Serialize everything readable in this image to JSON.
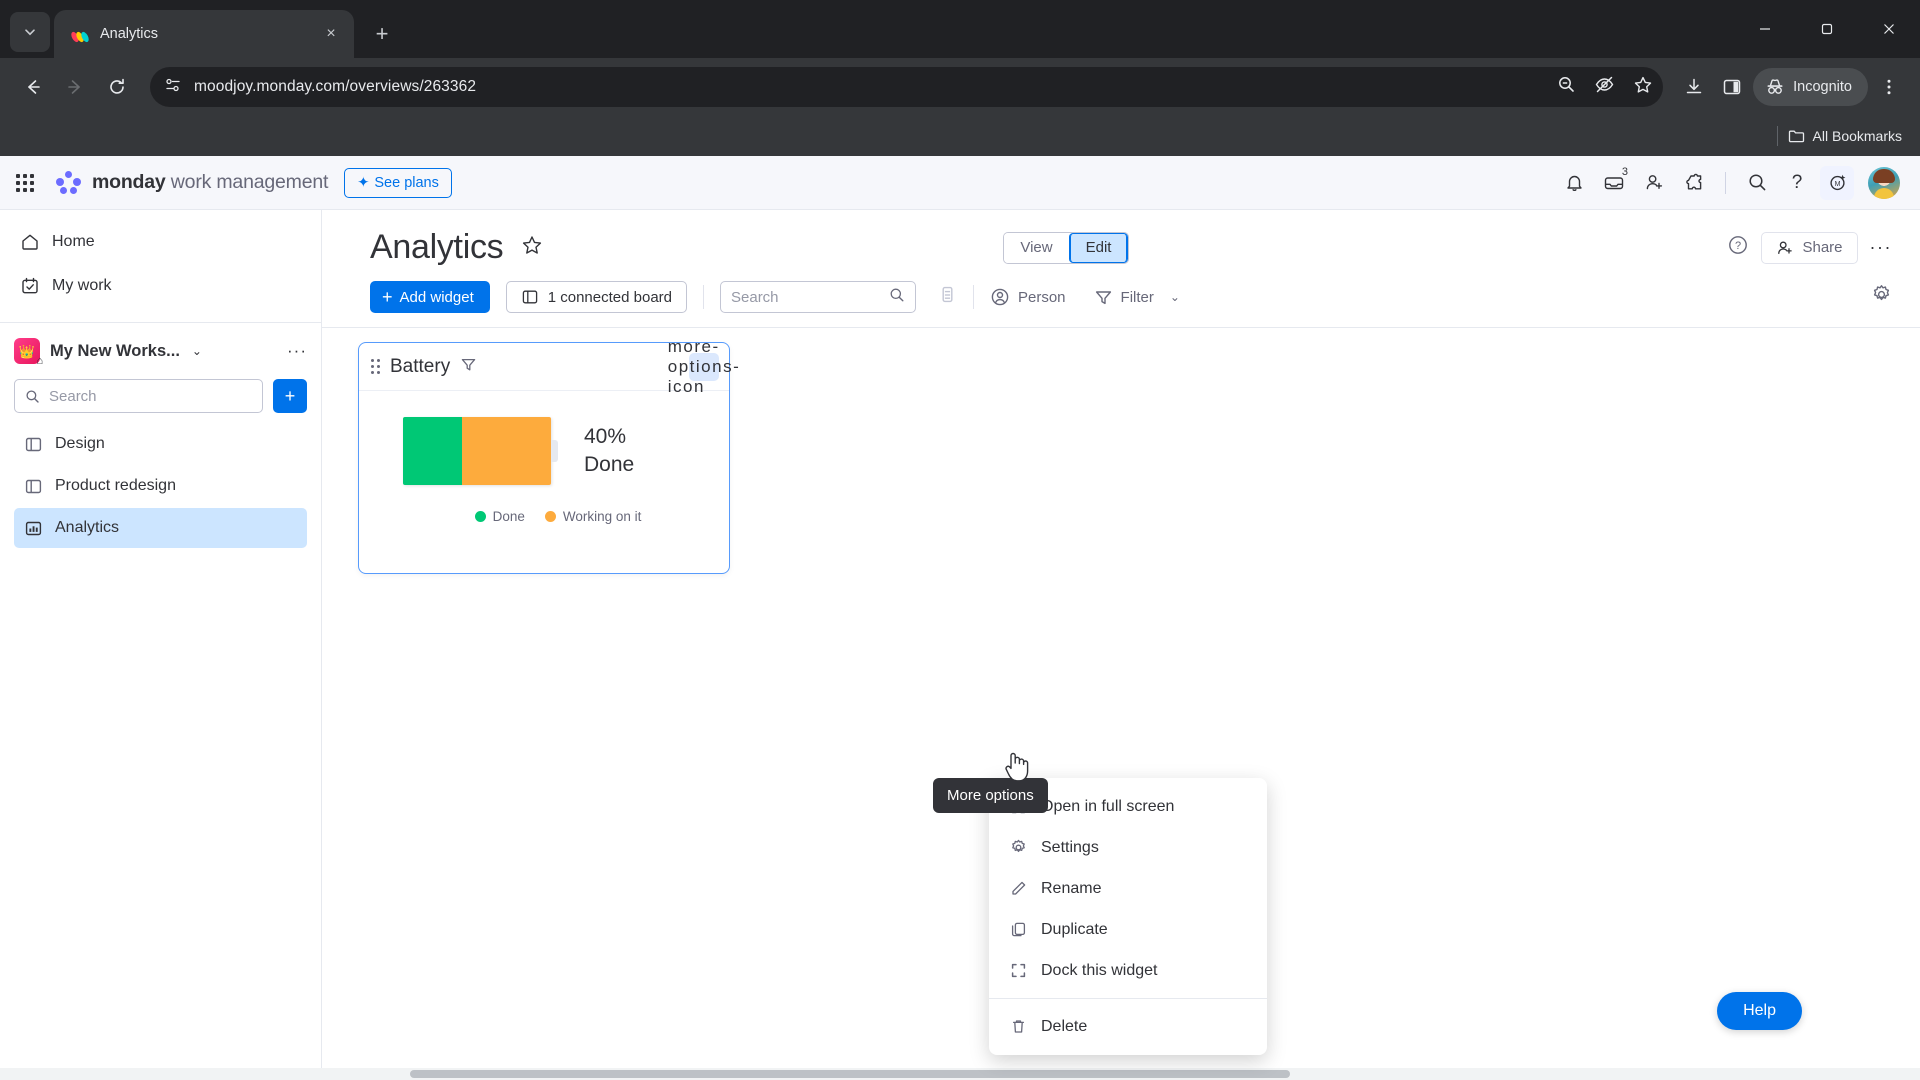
{
  "browser": {
    "tab": {
      "title": "Analytics",
      "favicon": "monday-logo-icon",
      "close": "×"
    },
    "new_tab_label": "+",
    "window": {
      "minimize": "—",
      "maximize": "▢",
      "close": "✕"
    },
    "nav": {
      "back": "←",
      "forward": "→",
      "reload": "⟳"
    },
    "omnibox": {
      "url": "moodjoy.monday.com/overviews/263362",
      "site_info_icon": "page-info-icon",
      "zoom_icon": "zoom-out-icon",
      "tracking_icon": "eye-off-icon",
      "bookmark_icon": "star-icon"
    },
    "toolbar_icons": {
      "downloads": "download-icon",
      "side_panel": "side-panel-icon",
      "incognito_label": "Incognito",
      "menu": "kebab-menu-icon"
    },
    "bookmarks_bar": {
      "all_bookmarks": "All Bookmarks",
      "folder_icon": "folder-icon"
    }
  },
  "app_header": {
    "waffle": "apps-grid-icon",
    "brand_bold": "monday",
    "brand_rest": " work management",
    "see_plans": "See plans",
    "icons": {
      "notifications": "bell-icon",
      "inbox": "inbox-icon",
      "inbox_badge": "3",
      "invite": "invite-member-icon",
      "apps": "puzzle-icon",
      "search": "search-icon",
      "help": "?",
      "monday_ai": "monday-ai-icon",
      "avatar": "user-avatar"
    }
  },
  "sidebar": {
    "nav": [
      {
        "label": "Home",
        "icon": "home-icon"
      },
      {
        "label": "My work",
        "icon": "my-work-icon"
      }
    ],
    "workspace": {
      "name": "My New Works...",
      "avatar_icon": "workspace-avatar",
      "caret": "⌄",
      "more": "···"
    },
    "search_placeholder": "Search",
    "add_button": "+",
    "boards": [
      {
        "label": "Design",
        "icon": "board-icon",
        "active": false
      },
      {
        "label": "Product redesign",
        "icon": "board-icon",
        "active": false
      },
      {
        "label": "Analytics",
        "icon": "dashboard-icon",
        "active": true
      }
    ]
  },
  "main": {
    "title": "Analytics",
    "favorite_icon": "star-outline-icon",
    "view_edit": {
      "view": "View",
      "edit": "Edit",
      "selected": "Edit"
    },
    "help_icon": "question-circle-icon",
    "share_label": "Share",
    "more_label": "···",
    "toolbar": {
      "add_widget": "Add widget",
      "connected_board": "1 connected board",
      "search_placeholder": "Search",
      "columns_icon": "columns-icon",
      "person": "Person",
      "filter": "Filter",
      "filter_caret": "⌄",
      "settings_icon": "gear-icon"
    }
  },
  "widget": {
    "title": "Battery",
    "filter_icon": "filter-icon",
    "more_icon": "more-options-icon",
    "grip_icon": "drag-handle-icon"
  },
  "chart_data": {
    "type": "bar",
    "title": "Battery",
    "categories": [
      "Done",
      "Working on it"
    ],
    "values": [
      40,
      60
    ],
    "colors": [
      "#00c875",
      "#fdab3d"
    ],
    "center_value": "40%",
    "center_label": "Done",
    "legend": [
      {
        "label": "Done",
        "color": "#00c875"
      },
      {
        "label": "Working on it",
        "color": "#fdab3d"
      }
    ],
    "legend_position": "bottom",
    "xlabel": "",
    "ylabel": "",
    "grid": false
  },
  "context_menu": {
    "items": [
      {
        "label": "Open in full screen",
        "icon": "fullscreen-icon"
      },
      {
        "label": "Settings",
        "icon": "gear-icon"
      },
      {
        "label": "Rename",
        "icon": "pencil-icon"
      },
      {
        "label": "Duplicate",
        "icon": "duplicate-icon"
      },
      {
        "label": "Dock this widget",
        "icon": "dock-icon"
      },
      {
        "label": "Delete",
        "icon": "trash-icon"
      }
    ]
  },
  "tooltip": {
    "text": "More options"
  },
  "help_widget": {
    "label": "Help"
  },
  "colors": {
    "accent": "#0073ea",
    "done_green": "#00c875",
    "working_orange": "#fdab3d",
    "selection_blue": "#cce5ff",
    "widget_border": "#579bfc"
  }
}
